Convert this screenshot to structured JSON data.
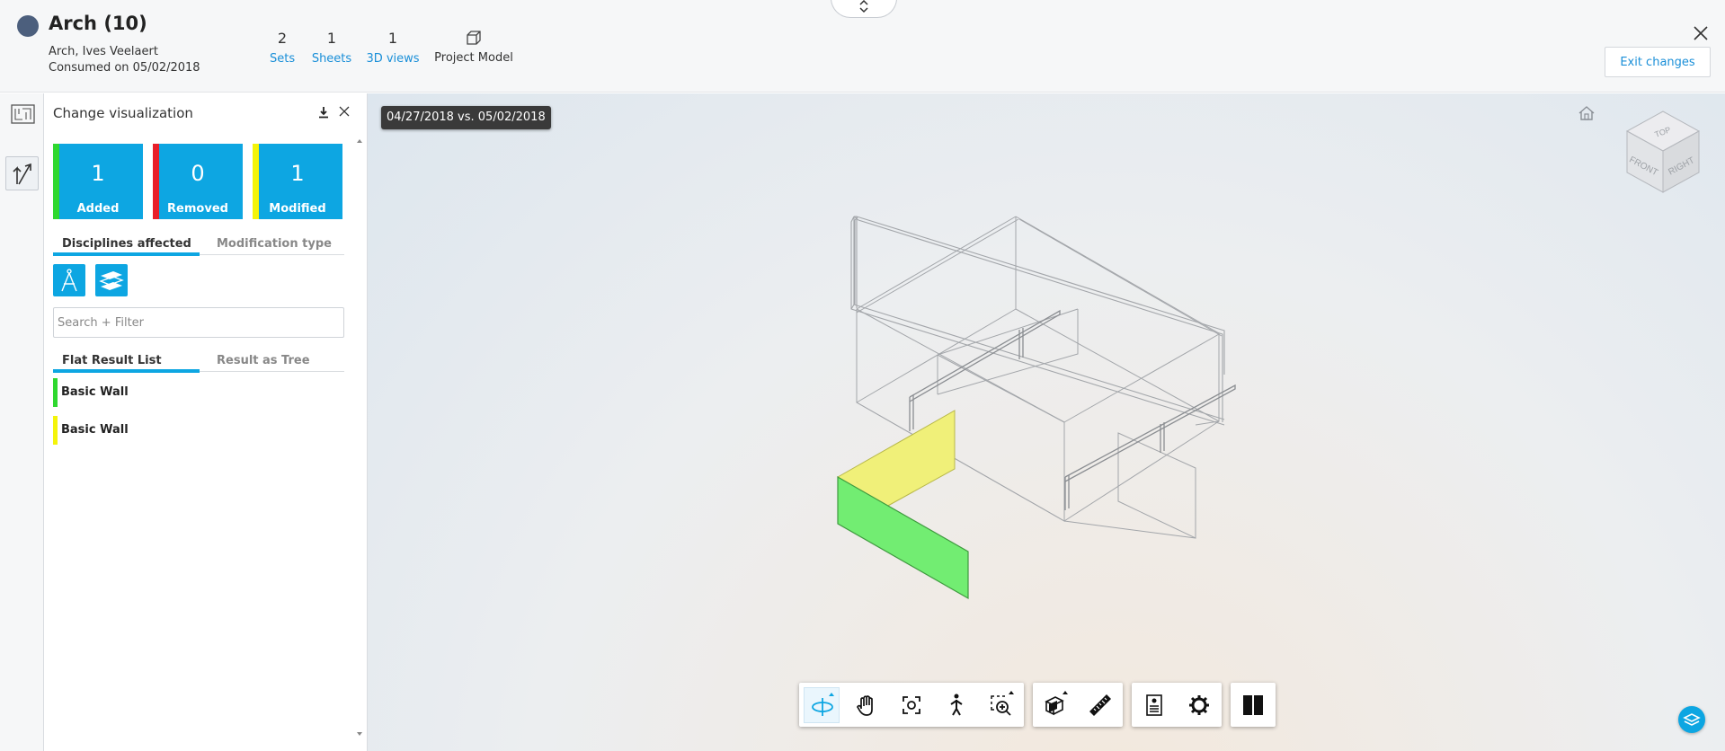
{
  "header": {
    "title": "Arch (10)",
    "author": "Arch, Ives Veelaert",
    "consumed": "Consumed on 05/02/2018",
    "stats": [
      {
        "num": "2",
        "label": "Sets"
      },
      {
        "num": "1",
        "label": "Sheets"
      },
      {
        "num": "1",
        "label": "3D views"
      }
    ],
    "project_model_label": "Project Model",
    "exit_label": "Exit changes"
  },
  "panel": {
    "title": "Change visualization",
    "cards": [
      {
        "count": "1",
        "label": "Added",
        "color": "#2fd82f"
      },
      {
        "count": "0",
        "label": "Removed",
        "color": "#e8202a"
      },
      {
        "count": "1",
        "label": "Modified",
        "color": "#f4f40a"
      }
    ],
    "tabs1": [
      "Disciplines affected",
      "Modification type"
    ],
    "search_placeholder": "Search + Filter",
    "tabs2": [
      "Flat Result List",
      "Result as Tree"
    ],
    "results": [
      {
        "label": "Basic Wall",
        "color": "#2fd82f"
      },
      {
        "label": "Basic Wall",
        "color": "#f4f40a"
      }
    ]
  },
  "viewer": {
    "comparison_label": "04/27/2018 vs. 05/02/2018",
    "viewcube_faces": [
      "TOP",
      "FRONT",
      "RIGHT"
    ],
    "accent": "#0da6e2"
  }
}
